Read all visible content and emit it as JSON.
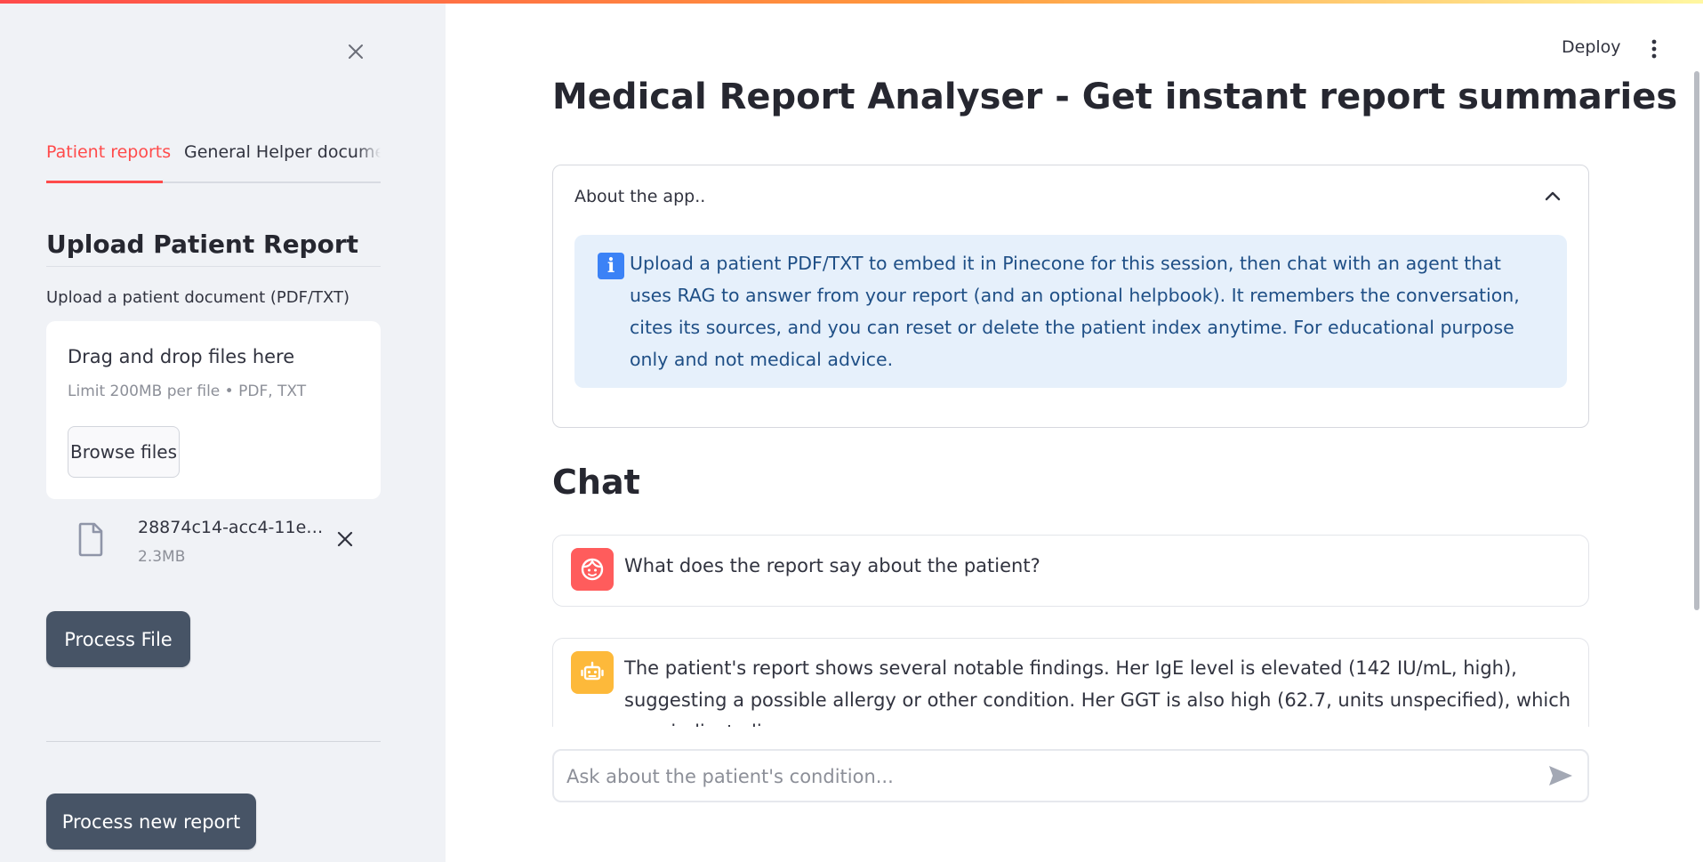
{
  "colors": {
    "accent": "#ff4b4b",
    "sidebar_bg": "#f0f2f6",
    "dark_button": "#475466",
    "info_bg": "#e6f0fb",
    "info_text": "#1f4f86",
    "user_avatar": "#ff5c5c",
    "bot_avatar": "#fdb93a"
  },
  "sidebar": {
    "tabs": [
      {
        "label": "Patient reports",
        "active": true
      },
      {
        "label": "General Helper documents",
        "active": false
      }
    ],
    "heading": "Upload Patient Report",
    "uploader": {
      "label": "Upload a patient document (PDF/TXT)",
      "drop_title": "Drag and drop files here",
      "limit": "Limit 200MB per file • PDF, TXT",
      "browse_label": "Browse files"
    },
    "file": {
      "name": "28874c14-acc4-11e…",
      "size": "2.3MB",
      "icon": "file-icon"
    },
    "process_file_label": "Process File",
    "process_new_label": "Process new report"
  },
  "header": {
    "deploy_label": "Deploy",
    "menu_icon": "kebab-menu-icon"
  },
  "main": {
    "title": "Medical Report Analyser - Get instant report summaries",
    "about": {
      "header": "About the app..",
      "expanded": true,
      "info_text": "Upload a patient PDF/TXT to embed it in Pinecone for this session, then chat with an agent that uses RAG to answer from your report (and an optional helpbook). It remembers the conversation, cites its sources, and you can reset or delete the patient index anytime. For educational purpose only and not medical advice."
    },
    "chat": {
      "heading": "Chat",
      "messages": [
        {
          "role": "user",
          "text": "What does the report say about the patient?"
        },
        {
          "role": "assistant",
          "text": "The patient's report shows several notable findings. Her IgE level is elevated (142 IU/mL, high), suggesting a possible allergy or other condition. Her GGT is also high (62.7, units unspecified), which may indicate liver"
        }
      ],
      "input_placeholder": "Ask about the patient's condition..."
    }
  }
}
